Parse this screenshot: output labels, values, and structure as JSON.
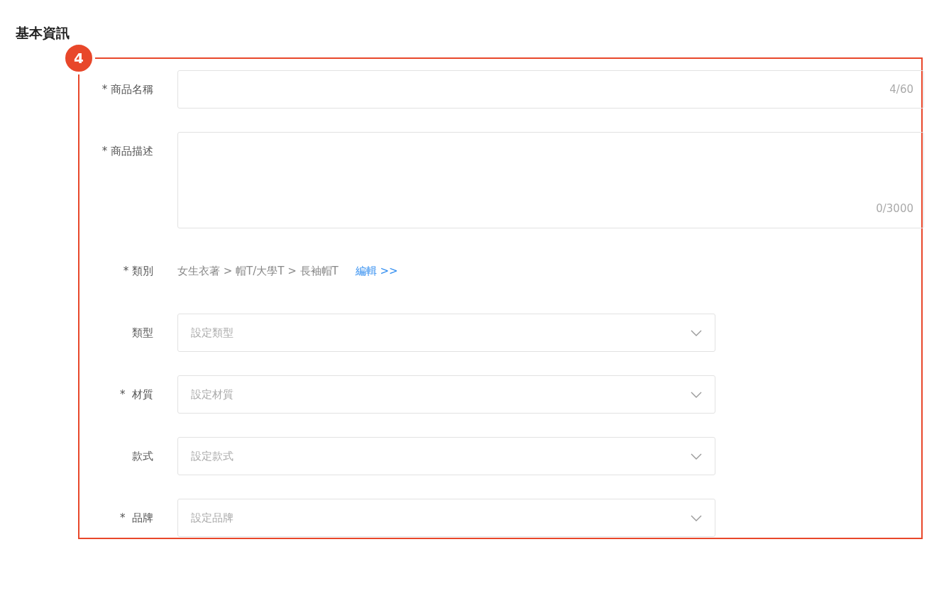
{
  "heading": "基本資訊",
  "marker": {
    "number": "4"
  },
  "fields": [
    {
      "kind": "text",
      "label": "* 商品名稱",
      "counter": "4/60"
    },
    {
      "kind": "textarea",
      "label": "* 商品描述",
      "counter": "0/3000"
    },
    {
      "kind": "path",
      "label": "* 類別",
      "value": "女生衣著 > 帽T/大學T > 長袖帽T",
      "link": "編輯 >>"
    },
    {
      "kind": "select",
      "label": "類型",
      "placeholder": "設定類型"
    },
    {
      "kind": "select",
      "label": "*  材質",
      "placeholder": "設定材質"
    },
    {
      "kind": "select",
      "label": "款式",
      "placeholder": "設定款式"
    },
    {
      "kind": "select",
      "label": "*  品牌",
      "placeholder": "設定品牌"
    }
  ]
}
